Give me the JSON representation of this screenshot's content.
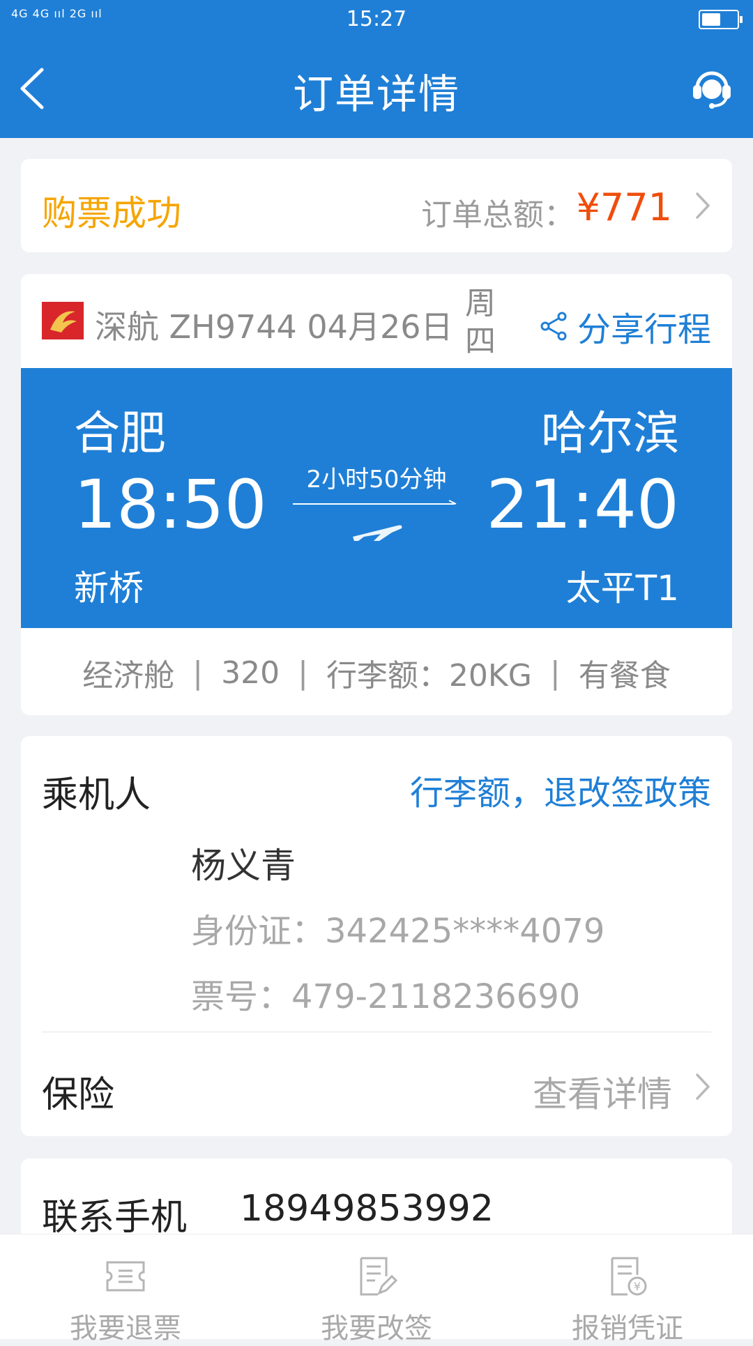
{
  "status_bar": {
    "network": "4G 4G ııl 2G ııl",
    "time": "15:27"
  },
  "header": {
    "title": "订单详情"
  },
  "order_status": {
    "status": "购票成功",
    "total_label": "订单总额：",
    "total_value": "¥771"
  },
  "flight": {
    "info": "深航 ZH9744 04月26日",
    "weekday": "周四",
    "share_label": "分享行程",
    "departure": {
      "city": "合肥",
      "time": "18:50",
      "airport": "新桥"
    },
    "arrival": {
      "city": "哈尔滨",
      "time": "21:40",
      "airport": "太平T1"
    },
    "duration": "2小时50分钟",
    "cabin": "经济舱",
    "aircraft": "320",
    "baggage": "行李额：20KG",
    "meal": "有餐食",
    "separator": "|"
  },
  "passenger": {
    "label": "乘机人",
    "policy_link": "行李额，退改签政策",
    "name": "杨义青",
    "id_line": "身份证：342425****4079",
    "ticket_line": "票号：479-2118236690"
  },
  "insurance": {
    "label": "保险",
    "link": "查看详情"
  },
  "contact": {
    "label": "联系手机",
    "phone": "18949853992"
  },
  "bottom_tabs": [
    {
      "label": "我要退票",
      "icon": "ticket-icon"
    },
    {
      "label": "我要改签",
      "icon": "edit-doc-icon"
    },
    {
      "label": "报销凭证",
      "icon": "receipt-icon"
    }
  ],
  "colors": {
    "primary": "#1f7fd6",
    "success": "#f5a500",
    "price": "#f04d0c"
  }
}
